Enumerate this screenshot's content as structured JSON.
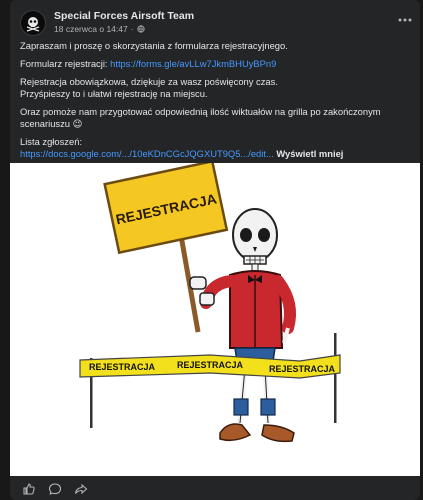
{
  "post": {
    "page_name": "Special Forces Airsoft Team",
    "date": "18 czerwca o 14:47",
    "separator": "·",
    "paragraph1": "Zapraszam i proszę o skorzystania z formularza rejestracyjnego.",
    "form_prefix": "Formularz rejestracji: ",
    "form_link": "https://forms.gle/avLLw7JkmBHUyBPn9",
    "para2_line1": "Rejestracja obowiązkowa, dziękuje za wasz poświęcony czas.",
    "para2_line2": "Przyśpieszy to i ułatwi rejestrację na miejscu.",
    "paragraph3": "Oraz pomoże nam przygotować odpowiednią ilość wiktuałów na grilla po zakończonym scenariuszu 😉",
    "list_label": "Lista zgłoszeń:",
    "docs_link": "https://docs.google.com/.../10eKDnCGcJQGXUT9Q5.../edit...",
    "see_more": "Wyświetl mniej"
  },
  "image": {
    "sign_text": "REJESTRACJA",
    "tape_text_1": "REJESTRACJA",
    "tape_text_2": "REJESTRACJA",
    "tape_text_3": "REJESTRACJA"
  },
  "icons": {
    "avatar": "skull-logo-icon",
    "privacy": "globe-icon",
    "menu": "more-options-icon",
    "like": "thumbs-up-icon",
    "comment": "comment-icon",
    "share": "share-icon"
  },
  "colors": {
    "card_bg": "#242526",
    "link": "#4599ff",
    "sign_yellow": "#f4c722",
    "jacket_red": "#c9282e"
  }
}
